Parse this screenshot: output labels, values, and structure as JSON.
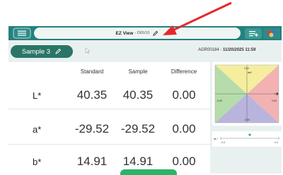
{
  "app": {
    "title_main": "EZ View",
    "title_sub": "- D65/10"
  },
  "sample": {
    "chip_label": "Sample 3"
  },
  "info": {
    "id": "AGR00184 -",
    "datetime": "11/20/2025 11:59"
  },
  "table": {
    "headers": [
      "Standard",
      "Sample",
      "Difference"
    ],
    "rows": [
      {
        "label": "L*",
        "standard": "40.35",
        "sample": "40.35",
        "difference": "0.00"
      },
      {
        "label": "a*",
        "standard": "-29.52",
        "sample": "-29.52",
        "difference": "0.00"
      },
      {
        "label": "b*",
        "standard": "14.91",
        "sample": "14.91",
        "difference": "0.00"
      }
    ]
  },
  "ab_plot": {
    "top": "0.60",
    "left": "-0.60",
    "right": "0.60",
    "bottom": "-0.60",
    "label": "da*",
    "quad_colors": [
      "#f4ee9e",
      "#f3b2b2",
      "#b6dcab",
      "#b9b4de"
    ]
  },
  "l_slider": {
    "label": "dL*",
    "min": "-0.6",
    "max": "0.6",
    "value": 0.0
  },
  "colors": {
    "teal_bar": "#25807f",
    "chip": "#2a7566",
    "panel_bg": "#e8f1ef",
    "arrow": "#e8262b",
    "bottom_button": "#2bb36a"
  },
  "icons": {
    "menu": "menu-icon",
    "edit": "pencil-icon",
    "tools": "list-add-icon",
    "color": "color-palette-icon",
    "cursor": "cursor-icon"
  }
}
